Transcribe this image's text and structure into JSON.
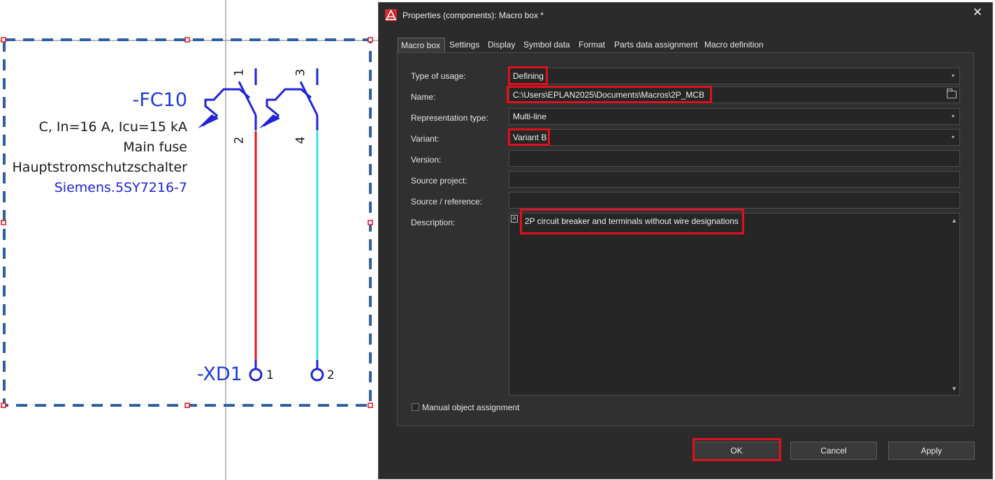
{
  "schematic": {
    "device_tag": "-FC10",
    "device_desc_lines": [
      "C, In=16 A, Icu=15 kA",
      "Main fuse",
      "Hauptstromschutzschalter"
    ],
    "part_number": "Siemens.5SY7216-7",
    "pole_labels": [
      "1",
      "2",
      "3",
      "4"
    ],
    "terminal_tag": "-XD1",
    "terminal_numbers": [
      "1",
      "2"
    ]
  },
  "dialog": {
    "title": "Properties (components): Macro box *",
    "tabs": [
      "Macro box",
      "Settings",
      "Display",
      "Symbol data",
      "Format",
      "Parts data assignment",
      "Macro definition"
    ],
    "active_tab": "Macro box",
    "fields": {
      "type_of_usage": {
        "label": "Type of usage:",
        "value": "Defining"
      },
      "name": {
        "label": "Name:",
        "value": "C:\\Users\\EPLAN2025\\Documents\\Macros\\2P_MCB"
      },
      "representation_type": {
        "label": "Representation type:",
        "value": "Multi-line"
      },
      "variant": {
        "label": "Variant:",
        "value": "Variant B"
      },
      "version": {
        "label": "Version:",
        "value": ""
      },
      "source_project": {
        "label": "Source project:",
        "value": ""
      },
      "source_reference": {
        "label": "Source / reference:",
        "value": ""
      },
      "description": {
        "label": "Description:",
        "value": "2P circuit breaker and terminals without wire designations"
      }
    },
    "manual_object_assignment": {
      "label": "Manual object assignment",
      "checked": false
    },
    "buttons": {
      "ok": "OK",
      "cancel": "Cancel",
      "apply": "Apply"
    }
  },
  "colors": {
    "highlight": "#e0101e",
    "dialog_bg": "#2b2b2b",
    "wire_red": "#e0141e",
    "wire_cyan": "#3ee0e6",
    "symbol_blue": "#1e24d8",
    "box_dash": "#2e5f9e"
  }
}
